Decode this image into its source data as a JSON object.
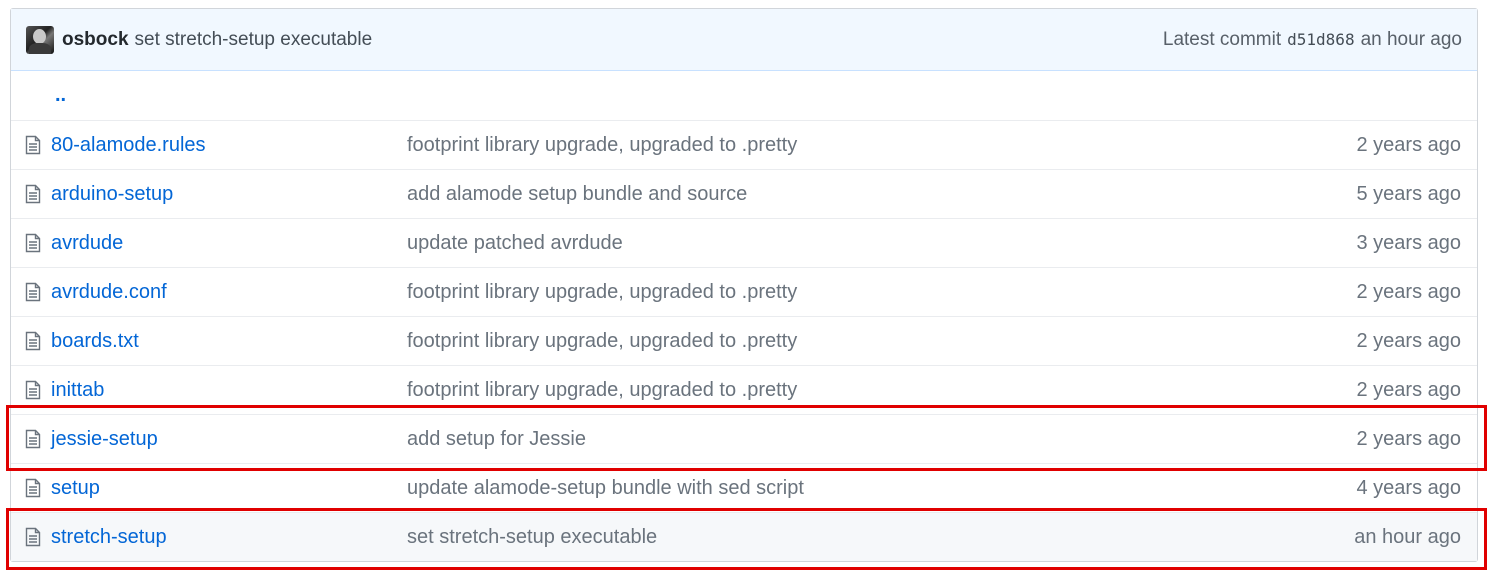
{
  "commit": {
    "author": "osbock",
    "message": "set stretch-setup executable",
    "latest_label": "Latest commit",
    "sha": "d51d868",
    "age": "an hour ago"
  },
  "up_link": "..",
  "files": [
    {
      "name": "80-alamode.rules",
      "message": "footprint library upgrade, upgraded to .pretty",
      "age": "2 years ago"
    },
    {
      "name": "arduino-setup",
      "message": "add alamode setup bundle and source",
      "age": "5 years ago"
    },
    {
      "name": "avrdude",
      "message": "update patched avrdude",
      "age": "3 years ago"
    },
    {
      "name": "avrdude.conf",
      "message": "footprint library upgrade, upgraded to .pretty",
      "age": "2 years ago"
    },
    {
      "name": "boards.txt",
      "message": "footprint library upgrade, upgraded to .pretty",
      "age": "2 years ago"
    },
    {
      "name": "inittab",
      "message": "footprint library upgrade, upgraded to .pretty",
      "age": "2 years ago"
    },
    {
      "name": "jessie-setup",
      "message": "add setup for Jessie",
      "age": "2 years ago"
    },
    {
      "name": "setup",
      "message": "update alamode-setup bundle with sed script",
      "age": "4 years ago"
    },
    {
      "name": "stretch-setup",
      "message": "set stretch-setup executable",
      "age": "an hour ago"
    }
  ],
  "icons": {
    "file": "file-icon",
    "avatar": "avatar"
  },
  "colors": {
    "link": "#0366d6",
    "highlight_box": "#e00000",
    "commit_bar_bg": "#f1f8ff"
  }
}
